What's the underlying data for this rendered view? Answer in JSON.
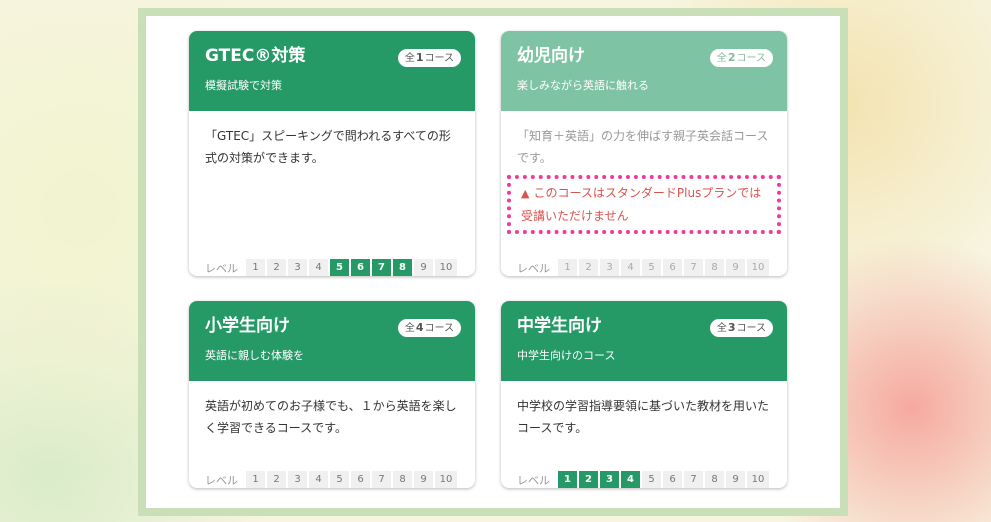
{
  "courses": [
    {
      "title": "GTEC®対策",
      "subtitle": "模擬試験で対策",
      "badge": {
        "prefix": "全",
        "count": "1",
        "suffix": "コース"
      },
      "description": "「GTEC」スピーキングで問われるすべての形式の対策ができます。",
      "levels_label": "レベル",
      "levels": [
        "1",
        "2",
        "3",
        "4",
        "5",
        "6",
        "7",
        "8",
        "9",
        "10"
      ],
      "active_levels": [
        5,
        6,
        7,
        8
      ]
    },
    {
      "title": "幼児向け",
      "subtitle": "楽しみながら英語に触れる",
      "badge": {
        "prefix": "全",
        "count": "2",
        "suffix": "コース"
      },
      "description": "「知育＋英語」の力を伸ばす親子英会話コースです。",
      "warning": "このコースはスタンダードPlusプランでは受講いただけません",
      "levels_label": "レベル",
      "levels": [
        "1",
        "2",
        "3",
        "4",
        "5",
        "6",
        "7",
        "8",
        "9",
        "10"
      ],
      "active_levels": []
    },
    {
      "title": "小学生向け",
      "subtitle": "英語に親しむ体験を",
      "badge": {
        "prefix": "全",
        "count": "4",
        "suffix": "コース"
      },
      "description": "英語が初めてのお子様でも、１から英語を楽しく学習できるコースです。",
      "levels_label": "レベル",
      "levels": [
        "1",
        "2",
        "3",
        "4",
        "5",
        "6",
        "7",
        "8",
        "9",
        "10"
      ],
      "active_levels": []
    },
    {
      "title": "中学生向け",
      "subtitle": "中学生向けのコース",
      "badge": {
        "prefix": "全",
        "count": "3",
        "suffix": "コース"
      },
      "description": "中学校の学習指導要領に基づいた教材を用いたコースです。",
      "levels_label": "レベル",
      "levels": [
        "1",
        "2",
        "3",
        "4",
        "5",
        "6",
        "7",
        "8",
        "9",
        "10"
      ],
      "active_levels": [
        1,
        2,
        3,
        4
      ]
    }
  ]
}
